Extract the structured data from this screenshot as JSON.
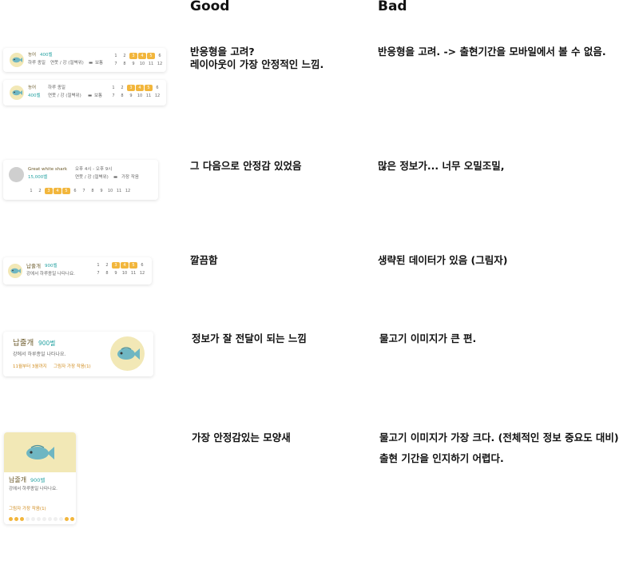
{
  "headers": {
    "good": "Good",
    "bad": "Bad"
  },
  "rows": [
    {
      "good": [
        "반응형을 고려?",
        "레이아웃이 가장 안정적인 느낌."
      ],
      "bad": [
        "반응형을 고려. -> 출현기간을 모바일에서 볼 수 없음."
      ]
    },
    {
      "good": [
        "그 다음으로 안정감 있었음"
      ],
      "bad": [
        "많은 정보가... 너무 오밀조밀,"
      ]
    },
    {
      "good": [
        "깔끔함"
      ],
      "bad": [
        "생략된 데이터가 있음 (그림자)"
      ]
    },
    {
      "good": [
        "정보가 잘 전달이 되는 느낌"
      ],
      "bad": [
        "물고기 이미지가 큰 편."
      ]
    },
    {
      "good": [
        "가장 안정감있는 모양새"
      ],
      "bad": [
        "물고기 이미지가 가장 크다. (전체적인 정보 중요도 대비)",
        "출현 기간을 인지하기 어렵다."
      ]
    }
  ],
  "colors": {
    "accent_yellow": "#f2b63c",
    "price_teal": "#27a3a3",
    "badge_bg": "#f2e8b6",
    "orange_text": "#d08a1a"
  },
  "months": [
    "1",
    "2",
    "3",
    "4",
    "5",
    "6",
    "7",
    "8",
    "9",
    "10",
    "11",
    "12"
  ],
  "card1": {
    "name": "농어",
    "price": "400벨",
    "time": "하루 종일",
    "place": "연못 / 강 (절벽위)",
    "shadow": "보통",
    "active_months": [
      3,
      4,
      5
    ]
  },
  "card2": {
    "name": "농어",
    "price": "400벨",
    "time": "하루 종일",
    "place": "연못 / 강 (절벽위)",
    "shadow": "보통",
    "active_months": [
      3,
      4,
      5
    ]
  },
  "card3": {
    "name": "Great white shark",
    "price": "15,000벨",
    "time": "오후 4시 - 오후 9시",
    "place": "연못 / 강 (절벽위)",
    "shadow": "가장 작음",
    "active_months": [
      3,
      4,
      5
    ]
  },
  "card4": {
    "name": "납줄개",
    "price": "900벨",
    "desc": "강에서 하루종일 나타나요.",
    "active_months": [
      3,
      4,
      5
    ]
  },
  "card5": {
    "name": "납줄개",
    "price": "900벨",
    "desc": "강에서 하루종일 나타나요.",
    "season": "11월부터 3월까지",
    "shadow": "그림자 가장 작음(1)"
  },
  "card6": {
    "name": "납줄개",
    "price": "900벨",
    "desc": "강에서 하루종일 나타나요.",
    "shadow": "그림자 가장 작음(1)",
    "active_months": [
      1,
      2,
      3,
      11,
      12
    ]
  }
}
